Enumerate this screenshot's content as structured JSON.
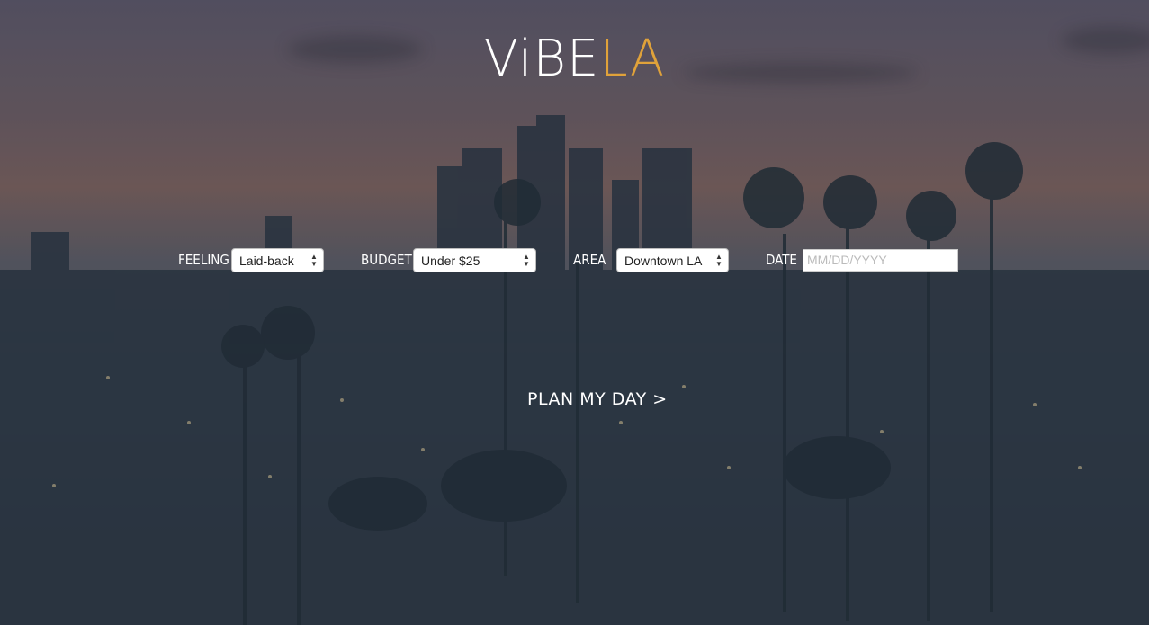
{
  "brand": {
    "part1": "ViBE",
    "part2": "LA",
    "accent_color": "#e0a23a"
  },
  "form": {
    "feeling": {
      "label": "FEELING",
      "selected": "Laid-back"
    },
    "budget": {
      "label": "BUDGET",
      "selected": "Under $25"
    },
    "area": {
      "label": "AREA",
      "selected": "Downtown LA"
    },
    "date": {
      "label": "DATE",
      "placeholder": "MM/DD/YYYY"
    }
  },
  "cta": {
    "label": "PLAN MY DAY >"
  },
  "background": {
    "description_icon": "los-angeles-skyline-image"
  }
}
